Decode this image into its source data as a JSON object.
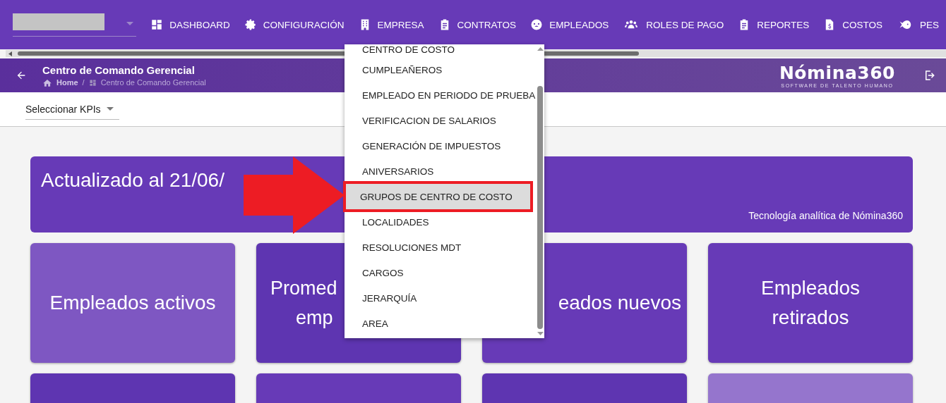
{
  "nav": [
    {
      "label": "DASHBOARD",
      "kind": "dashboard"
    },
    {
      "label": "CONFIGURACIÓN",
      "kind": "gear"
    },
    {
      "label": "EMPRESA",
      "kind": "building"
    },
    {
      "label": "CONTRATOS",
      "kind": "clipboard"
    },
    {
      "label": "EMPLEADOS",
      "kind": "face"
    },
    {
      "label": "ROLES DE PAGO",
      "kind": "people"
    },
    {
      "label": "REPORTES",
      "kind": "clipboard"
    },
    {
      "label": "COSTOS",
      "kind": "invoice"
    },
    {
      "label": "PES",
      "kind": "fish"
    }
  ],
  "header": {
    "title": "Centro de Comando Gerencial",
    "breadcrumb": [
      "Home",
      "/",
      "Centro de Comando Gerencial"
    ],
    "logo": "Nómina360",
    "logo_tagline": "SOFTWARE DE TALENTO HUMANO"
  },
  "kpi_select": {
    "label": "Seleccionar KPIs"
  },
  "banner": {
    "title": "Actualizado al 21/06/",
    "footer": "Tecnología analítica de Nómina360"
  },
  "cards": [
    {
      "lines": [
        "Empleados activos"
      ]
    },
    {
      "lines": [
        "Promed",
        "emp"
      ]
    },
    {
      "lines": [
        "eados nuevos"
      ]
    },
    {
      "lines": [
        "Empleados",
        "retirados"
      ]
    }
  ],
  "dropdown": [
    {
      "label": "CENTRO DE COSTO",
      "selected": false
    },
    {
      "label": "CUMPLEAÑEROS",
      "selected": false
    },
    {
      "label": "EMPLEADO EN PERIODO DE PRUEBA",
      "selected": false
    },
    {
      "label": "VERIFICACION DE SALARIOS",
      "selected": false
    },
    {
      "label": "GENERACIÓN DE IMPUESTOS",
      "selected": false
    },
    {
      "label": "ANIVERSARIOS",
      "selected": false
    },
    {
      "label": "GRUPOS DE CENTRO DE COSTO",
      "selected": true
    },
    {
      "label": "LOCALIDADES",
      "selected": false
    },
    {
      "label": "RESOLUCIONES MDT",
      "selected": false
    },
    {
      "label": "CARGOS",
      "selected": false
    },
    {
      "label": "JERARQUÍA",
      "selected": false
    },
    {
      "label": "AREA",
      "selected": false
    }
  ]
}
